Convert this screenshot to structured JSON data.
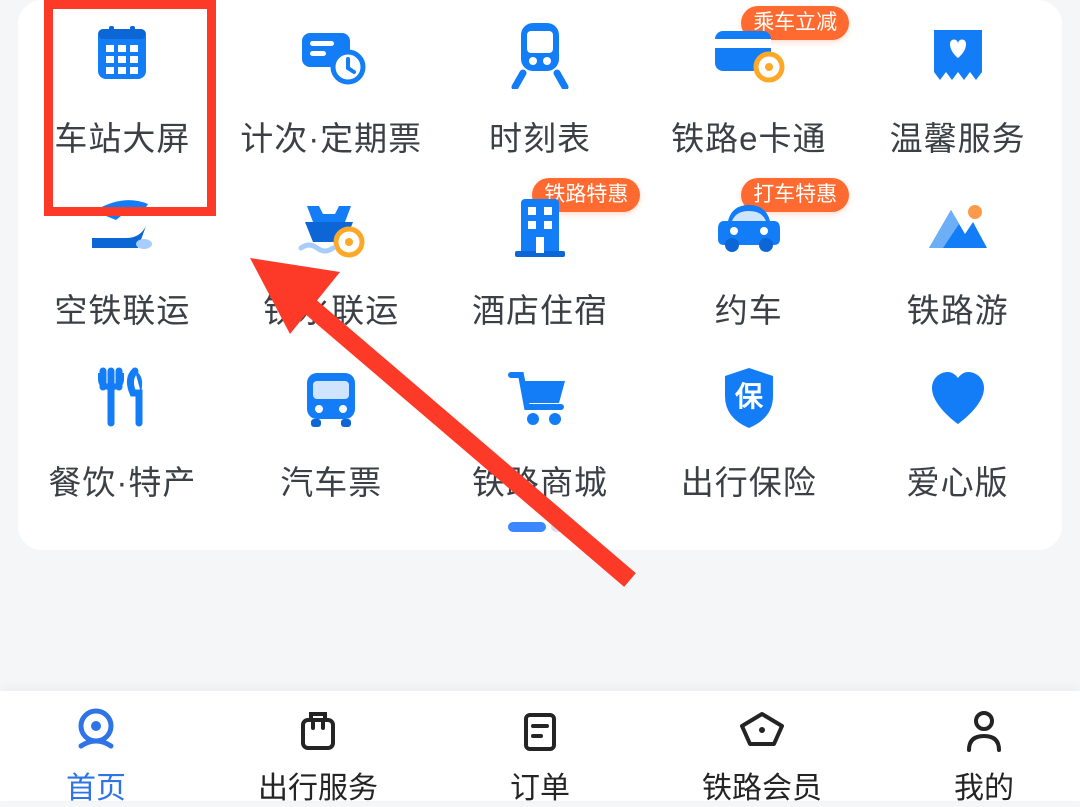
{
  "grid": {
    "items": [
      {
        "label": "车站大屏",
        "icon": "station-screen-icon",
        "badge": ""
      },
      {
        "label": "计次·定期票",
        "icon": "period-ticket-icon",
        "badge": ""
      },
      {
        "label": "时刻表",
        "icon": "timetable-icon",
        "badge": ""
      },
      {
        "label": "铁路e卡通",
        "icon": "e-card-icon",
        "badge": "乘车立减"
      },
      {
        "label": "温馨服务",
        "icon": "warm-service-icon",
        "badge": ""
      },
      {
        "label": "空铁联运",
        "icon": "air-rail-icon",
        "badge": ""
      },
      {
        "label": "铁水联运",
        "icon": "rail-water-icon",
        "badge": ""
      },
      {
        "label": "酒店住宿",
        "icon": "hotel-icon",
        "badge": "铁路特惠"
      },
      {
        "label": "约车",
        "icon": "taxi-icon",
        "badge": "打车特惠"
      },
      {
        "label": "铁路游",
        "icon": "railway-tour-icon",
        "badge": ""
      },
      {
        "label": "餐饮·特产",
        "icon": "food-icon",
        "badge": ""
      },
      {
        "label": "汽车票",
        "icon": "bus-ticket-icon",
        "badge": ""
      },
      {
        "label": "铁路商城",
        "icon": "railway-mall-icon",
        "badge": ""
      },
      {
        "label": "出行保险",
        "icon": "insurance-icon",
        "badge": ""
      },
      {
        "label": "爱心版",
        "icon": "love-version-icon",
        "badge": ""
      }
    ]
  },
  "insurance_glyph": "保",
  "nav": {
    "items": [
      {
        "label": "首页",
        "icon": "home-icon",
        "active": true
      },
      {
        "label": "出行服务",
        "icon": "travel-service-icon",
        "active": false
      },
      {
        "label": "订单",
        "icon": "orders-icon",
        "active": false
      },
      {
        "label": "铁路会员",
        "icon": "member-icon",
        "active": false
      },
      {
        "label": "我的",
        "icon": "profile-icon",
        "active": false
      }
    ]
  },
  "annotations": {
    "highlight_target": "车站大屏",
    "arrow_pointing_to": "车站大屏"
  },
  "colors": {
    "primary_blue": "#1d7cff",
    "accent_orange": "#fe6a30",
    "highlight_red": "#fc3a27"
  }
}
